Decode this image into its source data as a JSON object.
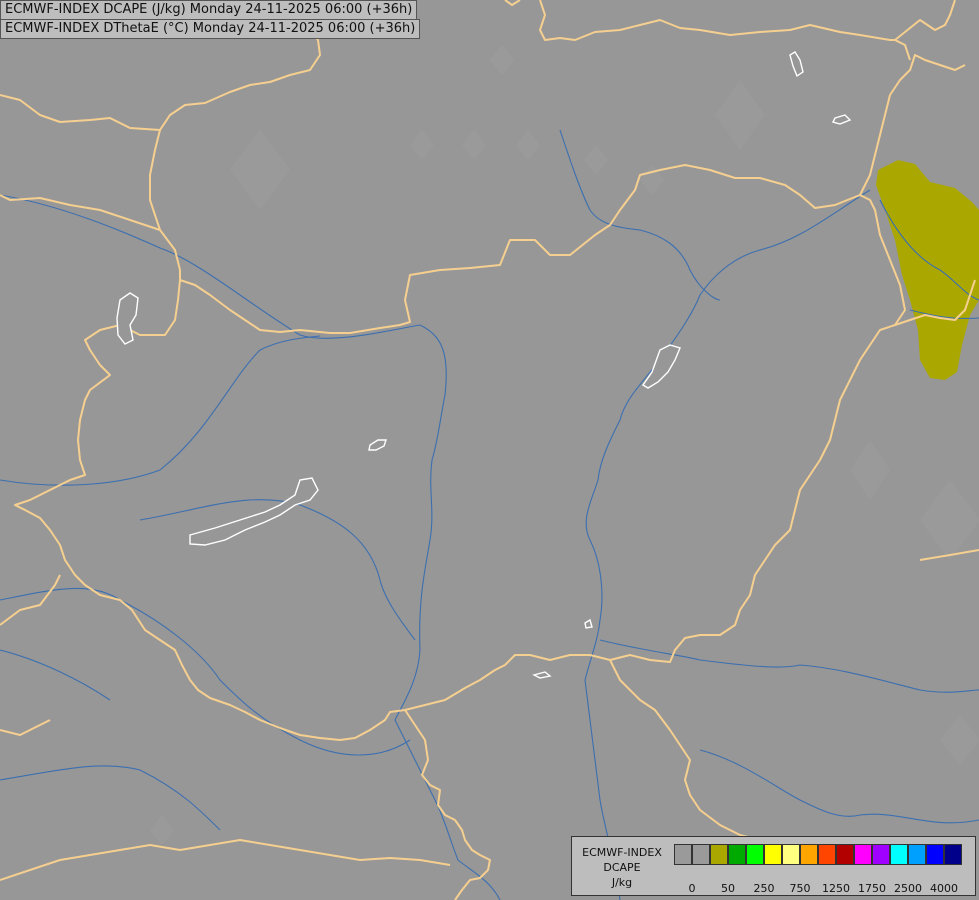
{
  "titles": [
    "ECMWF-INDEX DCAPE (J/kg) Monday 24-11-2025 06:00 (+36h)",
    "ECMWF-INDEX DThetaE (°C) Monday 24-11-2025 06:00 (+36h)"
  ],
  "colors": {
    "background": "#979797",
    "border": "#f5cf90",
    "river": "#3c6fb0",
    "lake": "#ffffff",
    "dcape_50": "#aaa800"
  },
  "legend": {
    "title_lines": [
      "ECMWF-INDEX",
      "DCAPE",
      "J/kg"
    ],
    "swatch_colors": [
      "#9a9a9a",
      "#9a9a9a",
      "#aaa800",
      "#00aa00",
      "#00ff00",
      "#ffff00",
      "#ffff80",
      "#ffa500",
      "#ff4500",
      "#b20000",
      "#ff00ff",
      "#a000ff",
      "#00ffff",
      "#00a0ff",
      "#0000ff",
      "#00008b"
    ],
    "tick_labels": [
      "0",
      "50",
      "250",
      "750",
      "1250",
      "1750",
      "2500",
      "4000"
    ]
  }
}
